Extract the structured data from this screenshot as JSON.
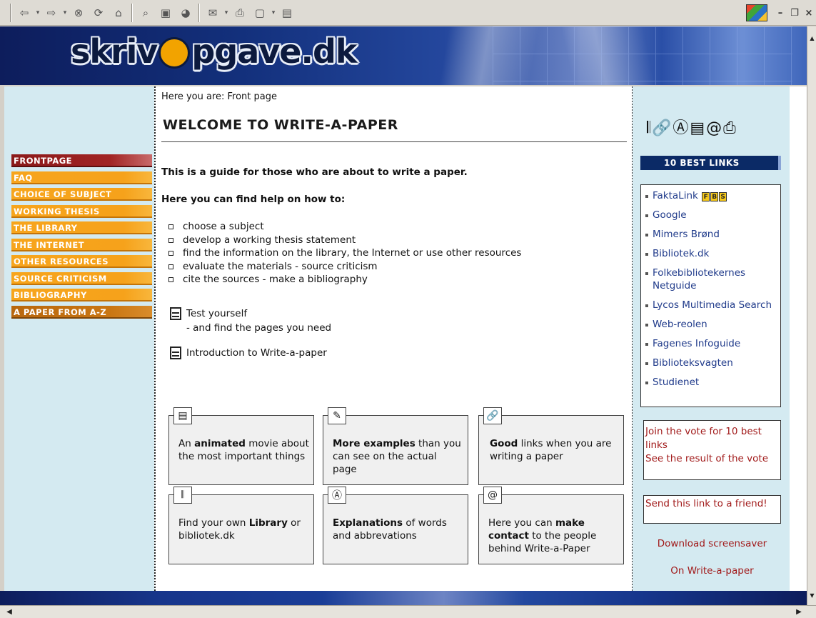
{
  "toolbar": {
    "back_icon": "back-arrow-icon",
    "forward_icon": "forward-arrow-icon",
    "window_controls": [
      "–",
      "Ɖ",
      "×"
    ]
  },
  "banner": {
    "logo_text_a": "skriv",
    "logo_text_b": "pgave.dk"
  },
  "breadcrumb": "Here you are: Front page",
  "page_title": "WELCOME TO WRITE-A-PAPER",
  "nav": {
    "items": [
      "FRONTPAGE",
      "FAQ",
      "CHOICE OF SUBJECT",
      "WORKING THESIS",
      "THE LIBRARY",
      "THE INTERNET",
      "OTHER RESOURCES",
      "SOURCE CRITICISM",
      "BIBLIOGRAPHY",
      "A PAPER FROM A-Z"
    ]
  },
  "main": {
    "lead": "This is a guide for those who are about to write a paper.",
    "sub": "Here you can find help on how to:",
    "bullets": [
      "choose a subject",
      "develop a working thesis statement",
      "find the information on the library, the Internet or use other resources",
      "evaluate the materials - source criticism",
      "cite the sources - make a bibliography"
    ],
    "test_line1": "Test yourself",
    "test_line2": "- and find the pages you need",
    "intro": "Introduction to Write-a-paper",
    "cards": [
      {
        "pre": "An ",
        "bold": "animated",
        "post": " movie about the most important things"
      },
      {
        "pre": "",
        "bold": "More examples",
        "post": " than you can see on the actual page"
      },
      {
        "pre": "",
        "bold": "Good",
        "post": " links when you are writing a paper"
      },
      {
        "pre": "Find your own ",
        "bold": "Library",
        "post": " or bibliotek.dk"
      },
      {
        "pre": "",
        "bold": "Explanations",
        "post": " of words and abbrevations"
      },
      {
        "pre": "Here you can ",
        "bold": "make contact",
        "post": " to the people behind Write-a-Paper"
      }
    ]
  },
  "right": {
    "best_links_header": "10 BEST LINKS",
    "links": [
      "FaktaLink",
      "Google",
      "Mimers Brønd",
      "Bibliotek.dk",
      "Folkebibliotekernes Netguide",
      "Lycos Multimedia Search",
      "Web-reolen",
      "Fagenes Infoguide",
      "Biblioteksvagten",
      "Studienet"
    ],
    "faktalink_tags": [
      "F",
      "B",
      "S"
    ],
    "vote_line1": "Join  the vote for 10 best links",
    "vote_line2": "See the result of the vote",
    "send_link": "Send this link to a friend!",
    "download": "Download screensaver",
    "on_write": "On Write-a-paper"
  }
}
